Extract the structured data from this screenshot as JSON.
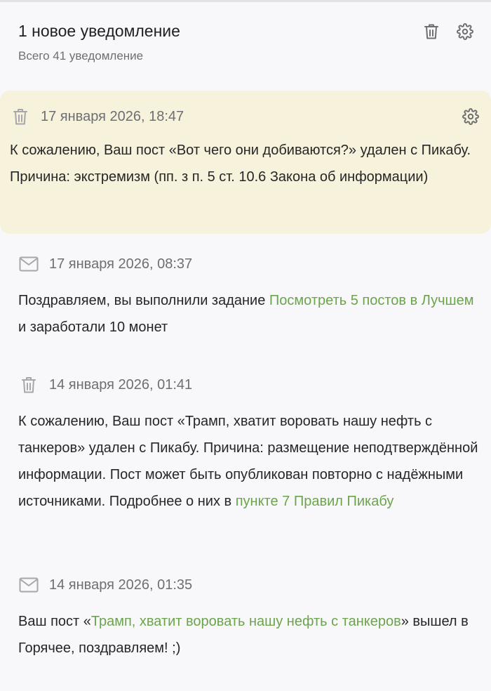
{
  "header": {
    "title": "1 новое уведомление",
    "subtitle": "Всего 41 уведомление",
    "delete_icon": "trash-icon",
    "settings_icon": "gear-icon"
  },
  "colors": {
    "unread_bg": "#f6f2db",
    "link": "#6ba44a",
    "text": "#262626",
    "muted": "#6e6e73"
  },
  "notifications": [
    {
      "icon": "trash-icon",
      "date": "17 января 2026, 18:47",
      "unread": true,
      "text": "К сожалению, Ваш пост «Вот чего они добиваются?» удален с Пикабу. Причина: экстремизм (пп. з п. 5 ст. 10.6 Закона об информации)"
    },
    {
      "icon": "mail-icon",
      "date": "17 января 2026, 08:37",
      "unread": false,
      "text_before": "Поздравляем, вы выполнили задание ",
      "link": "Посмотреть 5 постов в Лучшем",
      "text_after": " и заработали 10 монет"
    },
    {
      "icon": "trash-icon",
      "date": "14 января 2026, 01:41",
      "unread": false,
      "text_before": "К сожалению, Ваш пост «Трамп, хватит воровать нашу нефть с танкеров» удален с Пикабу. Причина: размещение неподтверждённой информации. Пост может быть опубликован повторно с надёжными источниками. Подробнее о них в ",
      "link": "пункте 7 Правил Пикабу"
    },
    {
      "icon": "mail-icon",
      "date": "14 января 2026, 01:35",
      "unread": false,
      "text_before": "Ваш пост «",
      "link": "Трамп, хватит воровать нашу нефть с танкеров",
      "text_after": "» вышел в Горячее, поздравляем! ;)"
    }
  ]
}
